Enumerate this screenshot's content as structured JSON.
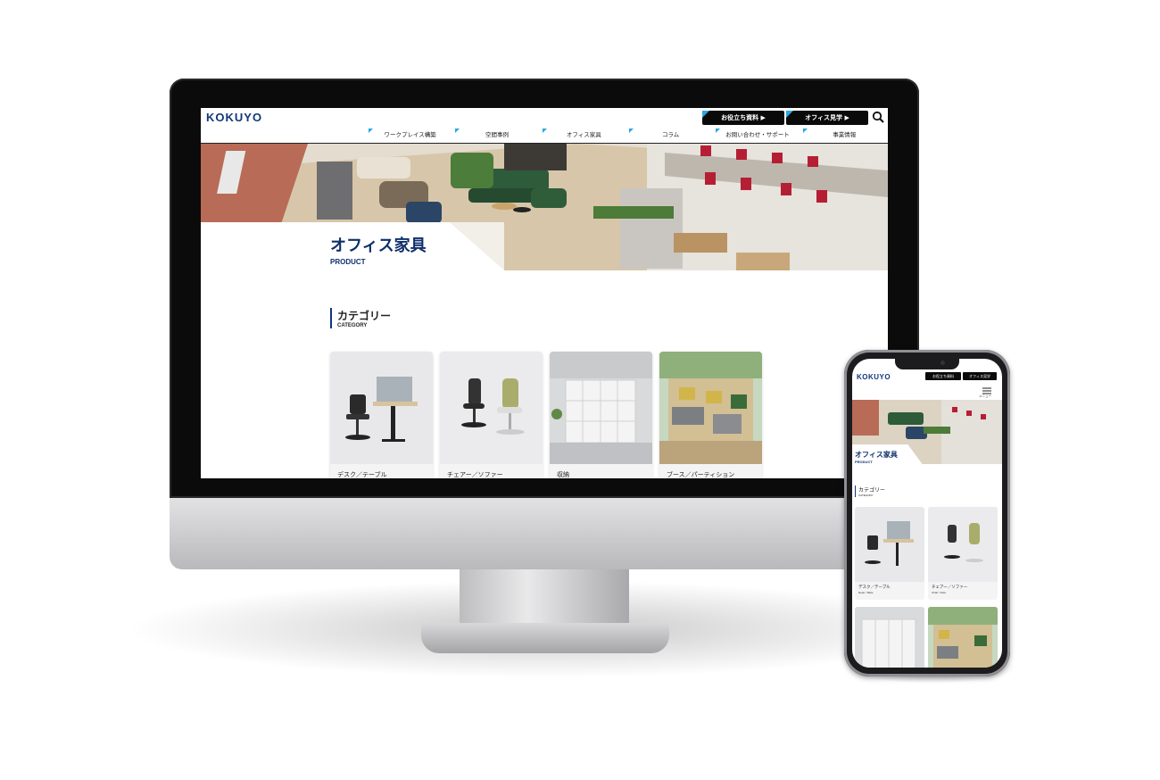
{
  "brand": {
    "logo_text": "KOKUYO",
    "color": "#11377a",
    "accent": "#2aa7e0"
  },
  "header": {
    "cta_useful": "お役立ち資料 ▶",
    "cta_tour": "オフィス見学 ▶",
    "search_icon": "search-icon",
    "nav": [
      "ワークプレイス構築",
      "空間事例",
      "オフィス家具",
      "コラム",
      "お問い合わせ・サポート",
      "事業情報"
    ]
  },
  "hero": {
    "title": "オフィス家具",
    "subtitle": "PRODUCT"
  },
  "category": {
    "title": "カテゴリー",
    "subtitle": "CATEGORY",
    "cards": [
      {
        "label": "デスク／テーブル",
        "sub": "Desk / Table"
      },
      {
        "label": "チェアー／ソファー",
        "sub": "Chair / Sofa"
      },
      {
        "label": "収納",
        "sub": ""
      },
      {
        "label": "ブース／パーティション",
        "sub": ""
      }
    ]
  },
  "mobile": {
    "cta_useful": "お役立ち資料",
    "cta_tour": "オフィス見学",
    "menu_label": "メニュー",
    "menu_icon": "hamburger-icon"
  }
}
